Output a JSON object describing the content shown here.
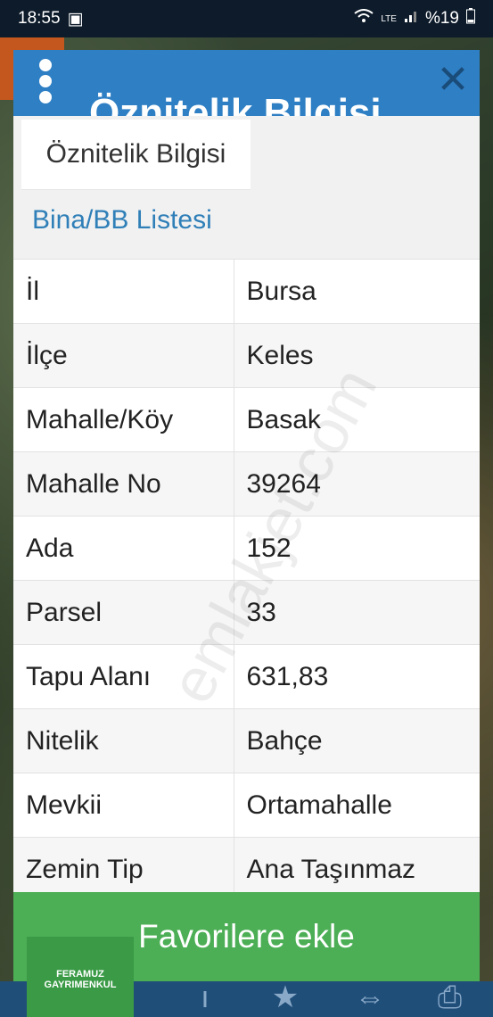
{
  "status_bar": {
    "time": "18:55",
    "battery": "%19",
    "network": "LTE"
  },
  "dialog": {
    "header_title": "Öznitelik Bilgisi",
    "close_symbol": "✕",
    "tab_label": "Öznitelik Bilgisi",
    "section_link": "Bina/BB Listesi",
    "rows": [
      {
        "key": "İl",
        "value": "Bursa"
      },
      {
        "key": "İlçe",
        "value": "Keles"
      },
      {
        "key": "Mahalle/Köy",
        "value": "Basak"
      },
      {
        "key": "Mahalle No",
        "value": "39264"
      },
      {
        "key": "Ada",
        "value": "152"
      },
      {
        "key": "Parsel",
        "value": "33"
      },
      {
        "key": "Tapu Alanı",
        "value": "631,83"
      },
      {
        "key": "Nitelik",
        "value": "Bahçe"
      },
      {
        "key": "Mevkii",
        "value": "Ortamahalle"
      },
      {
        "key": "Zemin Tip",
        "value": "Ana Taşınmaz"
      }
    ],
    "favorite_button": "Favorilere ekle"
  },
  "watermark": "emlakjet.com",
  "logo_text": "FERAMUZ GAYRIMENKUL",
  "icons": [
    "wifi-icon",
    "signal-icon",
    "battery-icon",
    "kebab-menu-icon",
    "close-icon",
    "star-icon",
    "print-icon",
    "arrows-icon"
  ]
}
